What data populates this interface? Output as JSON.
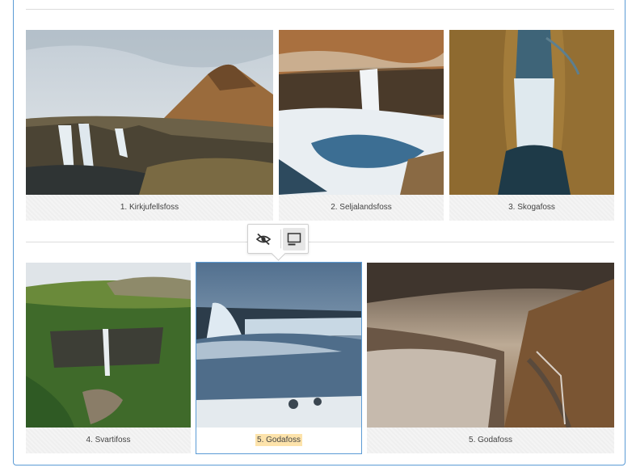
{
  "gallery": {
    "row1": [
      {
        "caption": "1. Kirkjufellsfoss"
      },
      {
        "caption": "2. Seljalandsfoss"
      },
      {
        "caption": "3. Skogafoss"
      }
    ],
    "row2": [
      {
        "caption": "4. Svartifoss"
      },
      {
        "caption": "5. Godafoss",
        "selected": true
      },
      {
        "caption": "5. Godafoss"
      }
    ]
  },
  "toolbar": {
    "buttons": [
      {
        "icon": "eye-off-icon",
        "active": false
      },
      {
        "icon": "caption-toggle-icon",
        "active": true
      }
    ]
  },
  "colors": {
    "selection": "#5b9bd5",
    "highlight": "#fde3ab"
  }
}
